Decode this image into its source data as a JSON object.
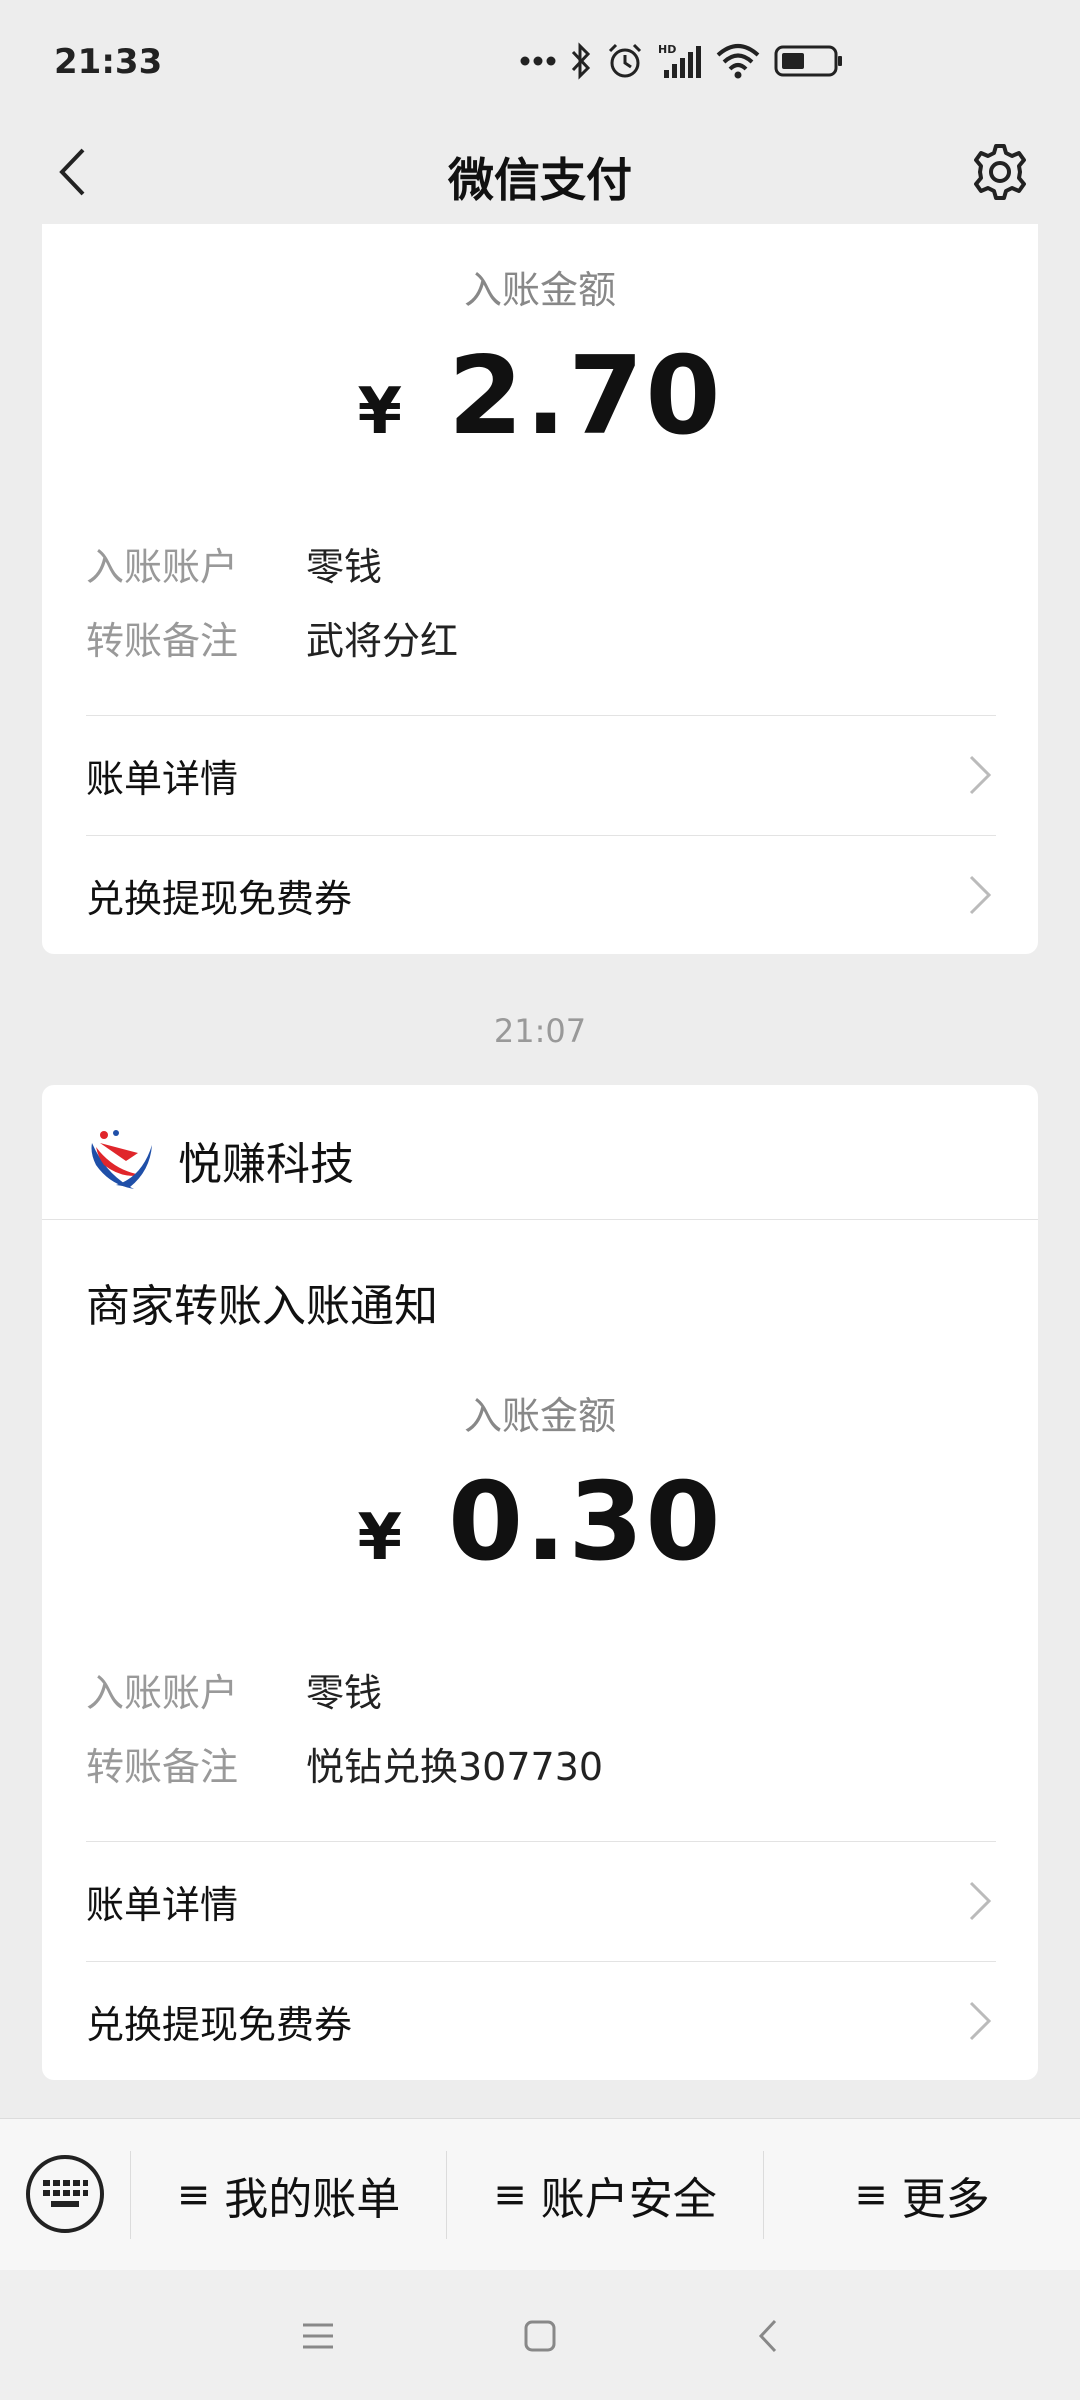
{
  "status_bar": {
    "time": "21:33",
    "icons": [
      "more-dots-icon",
      "bluetooth-icon",
      "alarm-icon",
      "hd-signal-icon",
      "wifi-icon",
      "battery-icon"
    ]
  },
  "nav": {
    "title": "微信支付",
    "back_icon": "chevron-left-icon",
    "settings_icon": "gear-icon"
  },
  "messages": [
    {
      "amount_label": "入账金额",
      "currency": "¥",
      "amount": "2.70",
      "account_key": "入账账户",
      "account_val": "零钱",
      "remark_key": "转账备注",
      "remark_val": "武将分红",
      "link1": "账单详情",
      "link2": "兑换提现免费券"
    },
    {
      "timestamp": "21:07",
      "merchant_name": "悦赚科技",
      "notice_title": "商家转账入账通知",
      "amount_label": "入账金额",
      "currency": "¥",
      "amount": "0.30",
      "account_key": "入账账户",
      "account_val": "零钱",
      "remark_key": "转账备注",
      "remark_val": "悦钻兑换307730",
      "link1": "账单详情",
      "link2": "兑换提现免费券"
    }
  ],
  "bottom_menu": {
    "items": [
      {
        "icon": "≡",
        "label": "我的账单"
      },
      {
        "icon": "≡",
        "label": "账户安全"
      },
      {
        "icon": "≡",
        "label": "更多"
      }
    ]
  },
  "colors": {
    "background": "#ededed",
    "card": "#ffffff",
    "muted_text": "#999999",
    "logo_red": "#e0262b",
    "logo_blue": "#1f4fa8"
  }
}
